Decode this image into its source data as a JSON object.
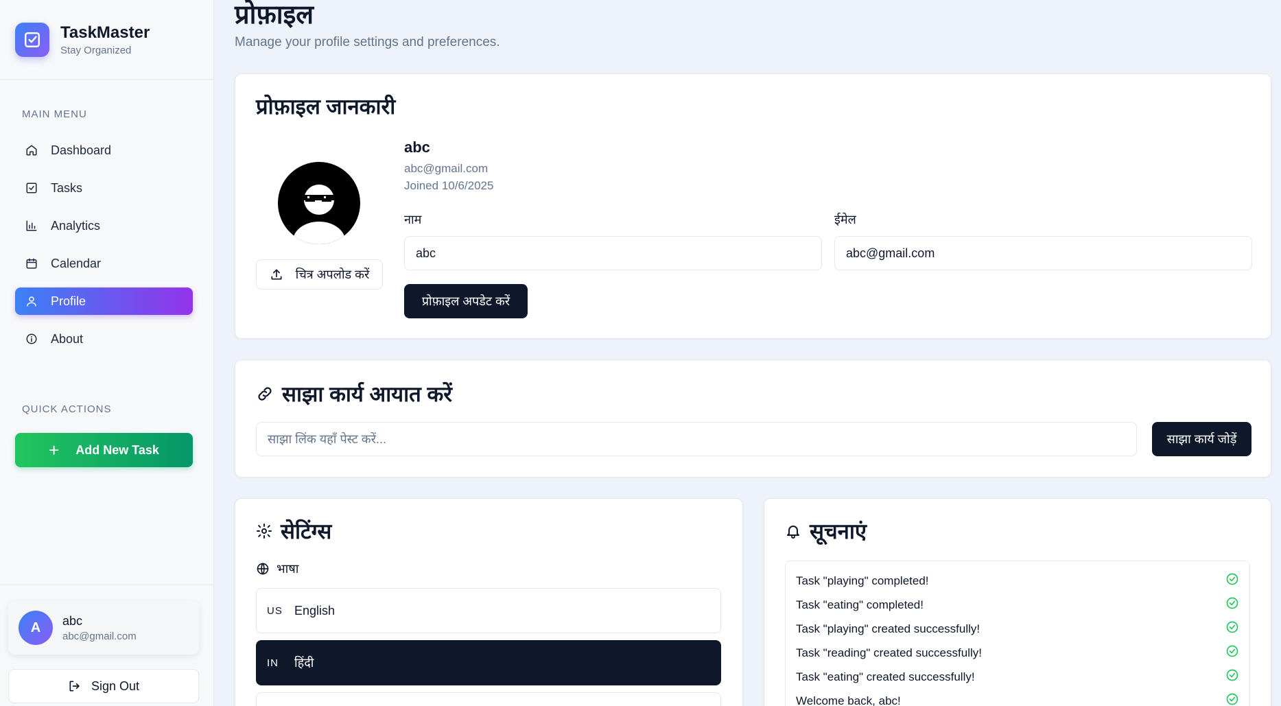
{
  "app": {
    "name": "TaskMaster",
    "tagline": "Stay Organized"
  },
  "sidebar": {
    "main_menu_label": "MAIN MENU",
    "items": [
      {
        "label": "Dashboard",
        "icon": "home-icon"
      },
      {
        "label": "Tasks",
        "icon": "checkbox-icon"
      },
      {
        "label": "Analytics",
        "icon": "bar-chart-icon"
      },
      {
        "label": "Calendar",
        "icon": "calendar-icon"
      },
      {
        "label": "Profile",
        "icon": "user-icon",
        "active": true
      },
      {
        "label": "About",
        "icon": "info-icon"
      }
    ],
    "quick_actions_label": "QUICK ACTIONS",
    "add_task_label": "Add New Task",
    "user": {
      "initial": "A",
      "name": "abc",
      "email": "abc@gmail.com"
    },
    "sign_out_label": "Sign Out"
  },
  "page": {
    "title": "प्रोफ़ाइल",
    "subtitle": "Manage your profile settings and preferences."
  },
  "profile_card": {
    "title": "प्रोफ़ाइल जानकारी",
    "upload_label": "चित्र अपलोड करें",
    "name": "abc",
    "email": "abc@gmail.com",
    "joined": "Joined 10/6/2025",
    "name_label": "नाम",
    "name_value": "abc",
    "email_label": "ईमेल",
    "email_value": "abc@gmail.com",
    "update_label": "प्रोफ़ाइल अपडेट करें"
  },
  "share_card": {
    "title": "साझा कार्य आयात करें",
    "placeholder": "साझा लिंक यहाँ पेस्ट करें...",
    "button_label": "साझा कार्य जोड़ें"
  },
  "settings_card": {
    "title": "सेटिंग्स",
    "language_label": "भाषा",
    "languages": [
      {
        "code": "US",
        "label": "English",
        "selected": false
      },
      {
        "code": "IN",
        "label": "हिंदी",
        "selected": true
      }
    ]
  },
  "notifications_card": {
    "title": "सूचनाएं",
    "items": [
      "Task \"playing\" completed!",
      "Task \"eating\" completed!",
      "Task \"playing\" created successfully!",
      "Task \"reading\" created successfully!",
      "Task \"eating\" created successfully!",
      "Welcome back, abc!"
    ]
  },
  "colors": {
    "accent_gradient_start": "#3b82f6",
    "accent_gradient_end": "#9333ea",
    "success_green": "#22c55e",
    "dark_button": "#0f172a"
  }
}
